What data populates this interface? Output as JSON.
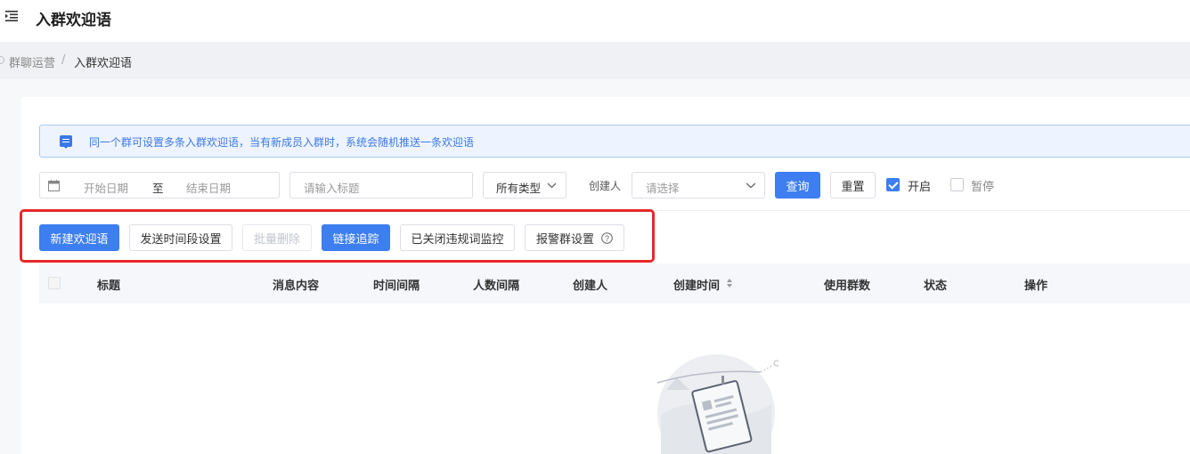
{
  "header": {
    "title": "入群欢迎语",
    "menu_icon": "menu-fold-icon"
  },
  "breadcrumb": {
    "items": [
      "群聊运营",
      "入群欢迎语"
    ],
    "separator": "/"
  },
  "notice": {
    "icon": "message-icon",
    "text": "同一个群可设置多条入群欢迎语，当有新成员入群时，系统会随机推送一条欢迎语"
  },
  "filters": {
    "date_icon": "calendar-icon",
    "start_placeholder": "开始日期",
    "range_sep": "至",
    "end_placeholder": "结束日期",
    "title_placeholder": "请输入标题",
    "type_value": "所有类型",
    "creator_label": "创建人",
    "creator_placeholder": "请选择",
    "query_label": "查询",
    "reset_label": "重置",
    "status_on_label": "开启",
    "status_on_checked": true,
    "status_off_label": "暂停",
    "status_off_checked": false
  },
  "actions": {
    "new_label": "新建欢迎语",
    "schedule_label": "发送时间段设置",
    "batch_delete_label": "批量删除",
    "link_track_label": "链接追踪",
    "monitor_label": "已关闭违规词监控",
    "alert_group_label": "报警群设置",
    "help_icon": "question-circle-icon"
  },
  "table": {
    "columns": [
      "标题",
      "消息内容",
      "时间间隔",
      "人数间隔",
      "创建人",
      "创建时间",
      "使用群数",
      "状态",
      "操作"
    ],
    "rows": []
  },
  "colors": {
    "primary": "#3d7ef0",
    "highlight_border": "#e8282b",
    "notice_bg": "#eef4ff"
  }
}
